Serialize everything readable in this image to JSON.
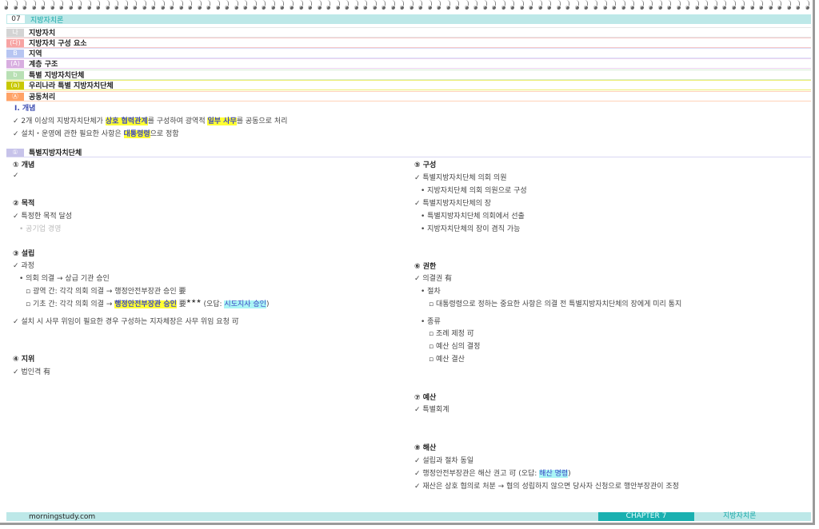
{
  "chapter": {
    "number": "07",
    "title": "지방자치론"
  },
  "toc": [
    {
      "badge": "나",
      "label": "지방자치",
      "color": "#d4d4d4",
      "line": "#e6e6e6"
    },
    {
      "badge": "(다)",
      "label": "지방자치 구성 요소",
      "color": "#f7a3a3",
      "line": "#f7c8c8"
    },
    {
      "badge": "B",
      "label": "지역",
      "color": "#b7c5f2",
      "line": "#dcdff7"
    },
    {
      "badge": "(A)",
      "label": "계층 구조",
      "color": "#d8aee0",
      "line": "#ecd3ef"
    },
    {
      "badge": "b",
      "label": "특별 지방자치단체",
      "color": "#b8e0b4",
      "line": "#d6edd3"
    },
    {
      "badge": "(a)",
      "label": "우리나라 특별 지방자치단체",
      "color": "#c8c800",
      "line": "#ecec70"
    },
    {
      "badge": "Ⓐ",
      "label": "공동처리",
      "color": "#ffa266",
      "line": "#ffd3b8"
    }
  ],
  "intro": {
    "heading": "Ⅰ. 개념",
    "line1": {
      "check": "✓",
      "a": "2개 이상의 지방자치단체가 ",
      "h1": "상호 협력관계",
      "b": "를 구성하여 광역적 ",
      "h2": "일부 사무",
      "c": "를 공동으로 처리"
    },
    "line2": {
      "check": "✓",
      "a": "설치・운영에 관한 필요한 사항은 ",
      "h1": "대통령령",
      "b": "으로 정함"
    }
  },
  "section": {
    "badge": "①",
    "title": "특별지방자치단체"
  },
  "left": {
    "s1": {
      "heading": "① 개념",
      "check": "✓"
    },
    "s2": {
      "heading": "② 목적",
      "l1": "✓ 특정한 목적 달성",
      "l2": "• 공기업 경영"
    },
    "s3": {
      "heading": "③ 설립",
      "l1": "✓ 과정",
      "l2": "• 의회 의결 → 상급 기관 승인",
      "l3": "▫ 광역 간: 각각 의회 의결 → 행정안전부장관 승인 要",
      "l4a": "▫ 기초 간: 각각 의회 의결 → ",
      "l4h": "행정안전부장관 승인",
      "l4b": " 要",
      "l4stars": "★★★",
      "l4c": " (오답: ",
      "l4h2": "시도지사 승인",
      "l4d": ")",
      "l5": "✓ 설치 시 사무 위임이 필요한 경우 구성하는 지자체장은 사무 위임 요청 可"
    },
    "s4": {
      "heading": "④ 지위",
      "l1": "✓ 법인격 有"
    }
  },
  "right": {
    "s5": {
      "heading": "⑤ 구성",
      "l1": "✓ 특별지방자치단체 의회 의원",
      "l2": "• 지방자치단체 의회 의원으로 구성",
      "l3": "✓ 특별지방자치단체의 장",
      "l4": "• 특별지방자치단체 의회에서 선출",
      "l5": "• 지방자치단체의 장이 겸직 가능"
    },
    "s6": {
      "heading": "⑥ 권한",
      "l1": "✓ 의결권 有",
      "l2": "• 절차",
      "l3": "▫ 대통령령으로 정하는 중요한 사항은 의결 전 특별지방자치단체의 장에게 미리 통지",
      "l4": "• 종류",
      "l5": "▫ 조례 제정 可",
      "l6": "▫ 예산 심의 결정",
      "l7": "▫ 예산 결산"
    },
    "s7": {
      "heading": "⑦ 예산",
      "l1": "✓ 특별회계"
    },
    "s8": {
      "heading": "⑧ 해산",
      "l1": "✓ 설립과 절차 동일",
      "l2a": "✓ 행정안전부장관은 해산 권고 可 (오답: ",
      "l2h": "해산 명령",
      "l2b": ")",
      "l3": "✓ 재산은 상호 협의로 처분 → 협의 성립하지 않으면 당사자 신청으로 행안부장관이 조정"
    }
  },
  "footer": {
    "site": "morningstudy.com",
    "chapter": "CHAPTER 7",
    "title": "지방자치론"
  }
}
